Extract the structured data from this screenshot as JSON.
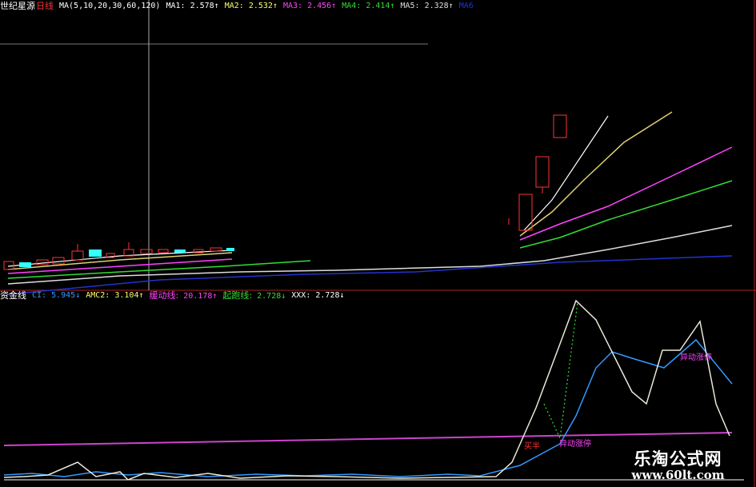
{
  "header": {
    "stock_name": "世纪星源",
    "period": "日线",
    "ma_params": "MA(5,10,20,30,60,120)",
    "ma": [
      {
        "label": "MA1:",
        "value": "2.578↑",
        "color": "#ffffff"
      },
      {
        "label": "MA2:",
        "value": "2.532↑",
        "color": "#ffff66"
      },
      {
        "label": "MA3:",
        "value": "2.456↑",
        "color": "#ff44ff"
      },
      {
        "label": "MA4:",
        "value": "2.414↑",
        "color": "#33dd33"
      },
      {
        "label": "MA5:",
        "value": "2.328↑",
        "color": "#dddddd"
      },
      {
        "label": "MA6",
        "value": "",
        "color": "#2222cc"
      }
    ]
  },
  "indicator": {
    "name": "资金线",
    "items": [
      {
        "label": "CI:",
        "value": "5.945↓",
        "color": "#3399ff"
      },
      {
        "label": "AMC2:",
        "value": "3.104↑",
        "color": "#ffff66"
      },
      {
        "label": "缓动线:",
        "value": "20.178↑",
        "color": "#ff44ff"
      },
      {
        "label": "起跑线:",
        "value": "2.728↓",
        "color": "#33dd33"
      },
      {
        "label": "XXX:",
        "value": "2.728↓",
        "color": "#ffffff"
      }
    ],
    "annotations": [
      {
        "text": "买半",
        "color": "#ff3333"
      },
      {
        "text": "异动涨停",
        "color": "#ff44ff"
      },
      {
        "text": "异动涨停",
        "color": "#ff44ff"
      }
    ]
  },
  "watermark": {
    "chinese": "乐淘公式网",
    "url": "www.60lt.com"
  },
  "colors": {
    "up_candle": "#ff3333",
    "down_candle": "#33ffff",
    "frame": "#aa2222",
    "crosshair": "#aaaaaa"
  }
}
